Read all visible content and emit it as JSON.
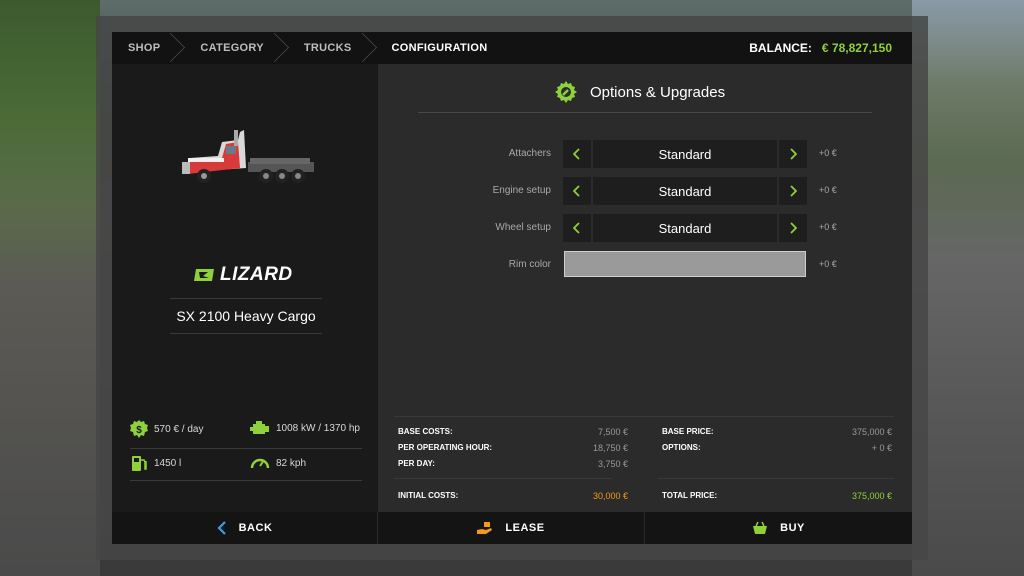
{
  "breadcrumb": [
    "SHOP",
    "CATEGORY",
    "TRUCKS",
    "CONFIGURATION"
  ],
  "balance": {
    "label": "BALANCE:",
    "value": "€ 78,827,150"
  },
  "vehicle": {
    "brand": "LIZARD",
    "model": "SX 2100 Heavy Cargo",
    "specs": {
      "cost_per_day": "570 € / day",
      "power": "1008 kW / 1370 hp",
      "fuel": "1450 l",
      "speed": "82 kph"
    }
  },
  "options": {
    "title": "Options & Upgrades",
    "rows": [
      {
        "label": "Attachers",
        "value": "Standard",
        "price": "+0 €"
      },
      {
        "label": "Engine setup",
        "value": "Standard",
        "price": "+0 €"
      },
      {
        "label": "Wheel setup",
        "value": "Standard",
        "price": "+0 €"
      },
      {
        "label": "Rim color",
        "value": "",
        "price": "+0 €",
        "color": "#9a9a9a"
      }
    ]
  },
  "costs": {
    "base_costs": {
      "label": "BASE COSTS:",
      "value": "7,500 €"
    },
    "per_hour": {
      "label": "PER OPERATING HOUR:",
      "value": "18,750 €"
    },
    "per_day": {
      "label": "PER DAY:",
      "value": "3,750 €"
    },
    "initial": {
      "label": "INITIAL COSTS:",
      "value": "30,000 €"
    },
    "base_price": {
      "label": "BASE PRICE:",
      "value": "375,000 €"
    },
    "options": {
      "label": "OPTIONS:",
      "value": "+ 0 €"
    },
    "total": {
      "label": "TOTAL PRICE:",
      "value": "375,000 €"
    }
  },
  "actions": {
    "back": "BACK",
    "lease": "LEASE",
    "buy": "BUY"
  },
  "colors": {
    "accent_green": "#8fd13b",
    "accent_orange": "#f39a1a",
    "back_blue": "#3aa0e0"
  }
}
